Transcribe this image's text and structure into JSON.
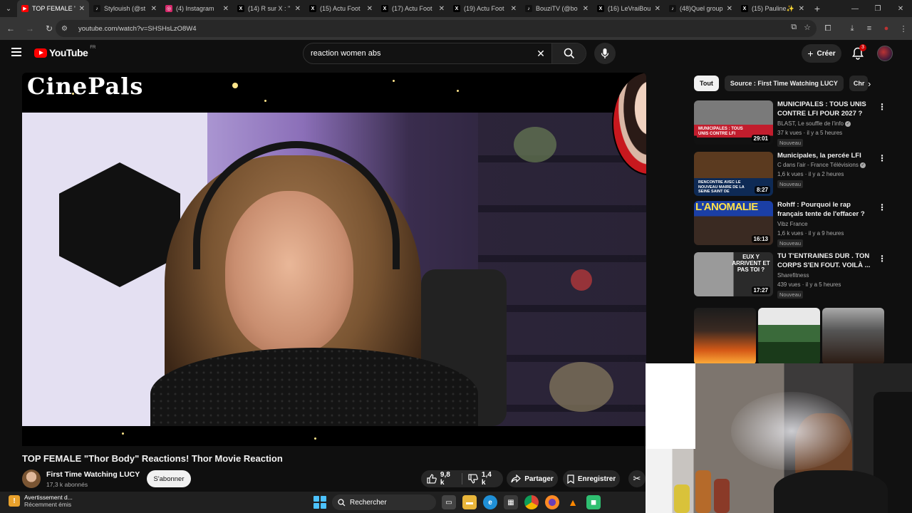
{
  "browser": {
    "tabs": [
      {
        "title": "TOP FEMALE \"T",
        "favicon": "youtube-icon",
        "active": true
      },
      {
        "title": "Stylouish (@st",
        "favicon": "tiktok-icon"
      },
      {
        "title": "(4) Instagram",
        "favicon": "instagram-icon"
      },
      {
        "title": "(14) R sur X : \"",
        "favicon": "x-icon"
      },
      {
        "title": "(15) Actu Foot",
        "favicon": "x-icon"
      },
      {
        "title": "(17) Actu Foot",
        "favicon": "x-icon"
      },
      {
        "title": "(19) Actu Foot",
        "favicon": "x-icon"
      },
      {
        "title": "BouziTV (@bo",
        "favicon": "tiktok-icon"
      },
      {
        "title": "(16) LeVraiBou",
        "favicon": "x-icon"
      },
      {
        "title": "(48)Quel group",
        "favicon": "tiktok-icon"
      },
      {
        "title": "(15) Pauline✨",
        "favicon": "x-icon"
      }
    ],
    "url": "youtube.com/watch?v=SHSHsLzO8W4"
  },
  "header": {
    "logo_text": "YouTube",
    "country": "FR",
    "search_query": "reaction women abs",
    "create_label": "Créer",
    "notification_count": "3"
  },
  "player": {
    "brand_overlay": "CinePals"
  },
  "video": {
    "title": "TOP FEMALE \"Thor Body\" Reactions! Thor Movie Reaction",
    "channel": "First Time Watching LUCY",
    "subscribers": "17,3 k abonnés",
    "subscribe_label": "S'abonner",
    "likes": "9,8 k",
    "dislikes": "1,4 k",
    "share_label": "Partager",
    "save_label": "Enregistrer"
  },
  "sidebar": {
    "chips": [
      "Tout",
      "Source : First Time Watching LUCY",
      "Chr"
    ],
    "recommendations": [
      {
        "title": "MUNICIPALES : TOUS UNIS CONTRE LFI POUR 2027 ?",
        "channel": "BLAST, Le souffle de l'info",
        "verified": true,
        "meta": "37 k vues · il y a 5 heures",
        "badge": "Nouveau",
        "duration": "29:01"
      },
      {
        "title": "Municipales, la percée LFI",
        "channel": "C dans l'air - France Télévisions",
        "verified": true,
        "meta": "1,6 k vues · il y a 2 heures",
        "badge": "Nouveau",
        "duration": "8:27"
      },
      {
        "title": "Rohff : Pourquoi le rap français tente de l'effacer ? ...",
        "channel": "Vibz France",
        "verified": false,
        "meta": "1,6 k vues · il y a 9 heures",
        "badge": "Nouveau",
        "duration": "16:13"
      },
      {
        "title": "TU T'ENTRAINES DUR . TON CORPS S'EN FOUT. VOILÀ ...",
        "channel": "Sharefitness",
        "verified": false,
        "meta": "439 vues · il y a 5 heures",
        "badge": "Nouveau",
        "duration": "17:27"
      }
    ],
    "thumb_texts": [
      "MUNICIPALES : TOUS UNIS CONTRE LFI",
      "RENCONTRE AVEC LE NOUVEAU MAIRE DE LA SEINE SAINT DE",
      "L'ANOMALIE",
      "EUX Y ARRIVENT ET PAS TOI ?"
    ]
  },
  "taskbar": {
    "notification_title": "Avertissement d...",
    "notification_sub": "Récemment émis",
    "search_label": "Rechercher"
  },
  "colors": {
    "youtube_red": "#ff0000",
    "background": "#0f0f0f",
    "chip_bg": "#272727"
  }
}
